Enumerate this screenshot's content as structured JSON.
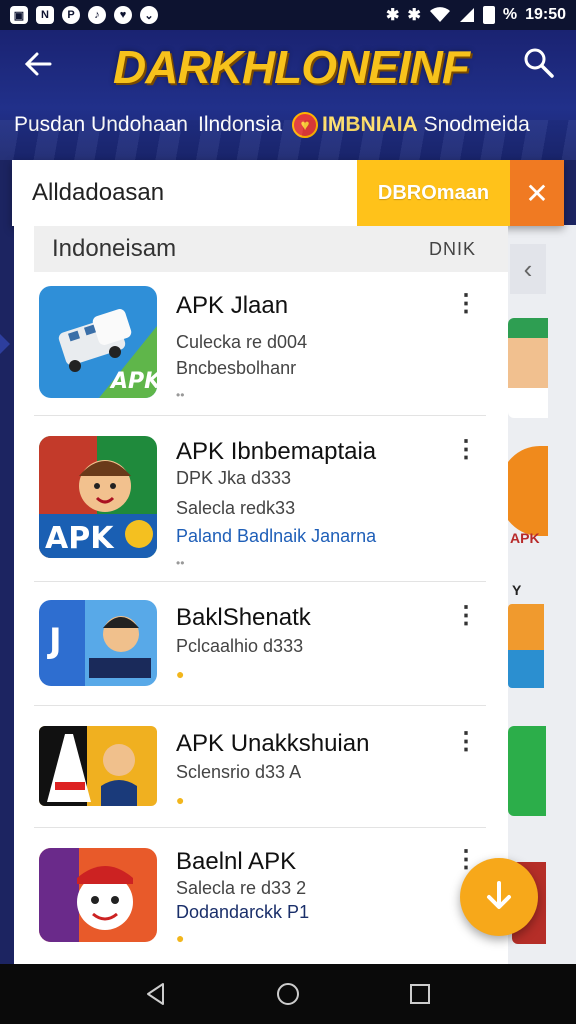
{
  "status_bar": {
    "notification_icons": [
      "image-icon",
      "news-icon",
      "pinterest-icon",
      "music-icon",
      "heart-icon",
      "chevron-down-icon"
    ],
    "right_icons": [
      "bluetooth-icon",
      "bluetooth-icon",
      "wifi-icon",
      "signal-icon"
    ],
    "battery": "%",
    "time": "19:50"
  },
  "header": {
    "title": "DARKHLONEINF",
    "subtitle": "Pusdan Undohaan",
    "subtitle2": "Ilndonsia",
    "brand_bold": "IMBNIAIA",
    "brand_rest": "Snodmeida"
  },
  "search": {
    "placeholder": "Alldadoasan",
    "download_label": "DBROmaan",
    "close_label": "✕"
  },
  "section": {
    "title": "Indoneisam",
    "action": "DNIK"
  },
  "apps": [
    {
      "title": "APK Jlaan",
      "line1": "Culecka re d004",
      "line2": "Bncbesbolhanr",
      "line3": "",
      "dot": "••"
    },
    {
      "title": "APK Ibnbemaptaia",
      "line1": "DPK Jka d333",
      "line2": "Salecla redk33",
      "line3": "Paland Badlnaik Janarna",
      "dot": "••"
    },
    {
      "title": "BaklShenatk",
      "line1": "Pclcaalhio d333",
      "line2": "",
      "line3": "",
      "dot": "●"
    },
    {
      "title": "APK Unakkshuian",
      "line1": "Sclensrio d33 A",
      "line2": "",
      "line3": "",
      "dot": "●"
    },
    {
      "title": "Baelnl APK",
      "line1": "Salecla re d33 2",
      "line2": "Dodandarckk P1",
      "line3": "",
      "dot": "●"
    }
  ],
  "background_peek": {
    "apk_label": "APK",
    "label": "Y"
  },
  "colors": {
    "header_bg": "#1c2461",
    "title_yellow": "#f7c21c",
    "download_yellow": "#ffc21a",
    "close_orange": "#f07a22",
    "fab_orange": "#f7a81a"
  }
}
